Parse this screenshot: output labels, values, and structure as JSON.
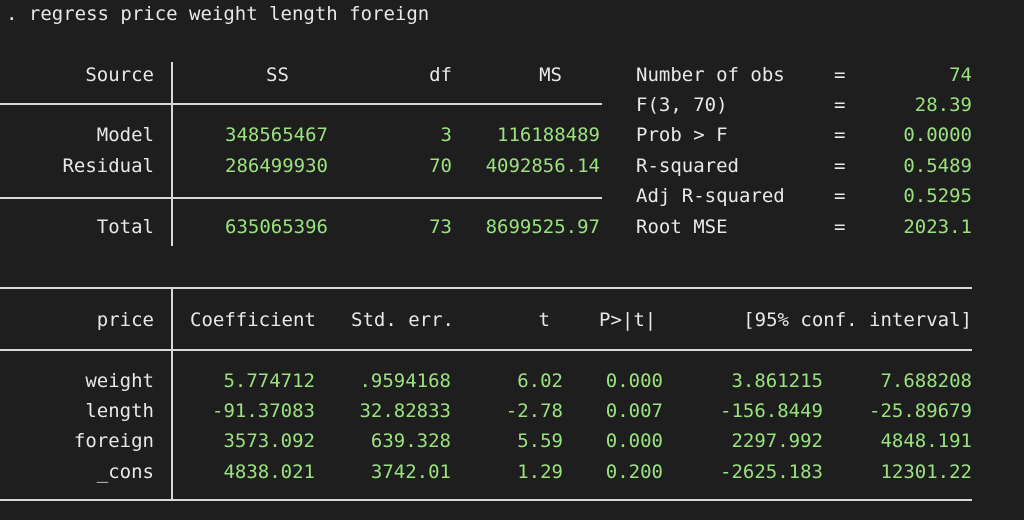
{
  "command": ". regress price weight length foreign",
  "anova": {
    "headers": {
      "source": "Source",
      "ss": "SS",
      "df": "df",
      "ms": "MS"
    },
    "rows": [
      {
        "source": "Model",
        "ss": "348565467",
        "df": "3",
        "ms": "116188489"
      },
      {
        "source": "Residual",
        "ss": "286499930",
        "df": "70",
        "ms": "4092856.14"
      }
    ],
    "total": {
      "source": "Total",
      "ss": "635065396",
      "df": "73",
      "ms": "8699525.97"
    }
  },
  "stats": [
    {
      "label": "Number of obs",
      "eq": "=",
      "value": "74"
    },
    {
      "label": "F(3, 70)",
      "eq": "=",
      "value": "28.39"
    },
    {
      "label": "Prob > F",
      "eq": "=",
      "value": "0.0000"
    },
    {
      "label": "R-squared",
      "eq": "=",
      "value": "0.5489"
    },
    {
      "label": "Adj R-squared",
      "eq": "=",
      "value": "0.5295"
    },
    {
      "label": "Root MSE",
      "eq": "=",
      "value": "2023.1"
    }
  ],
  "coef": {
    "headers": {
      "var": "price",
      "coef": "Coefficient",
      "se": "Std. err.",
      "t": "t",
      "p": "P>|t|",
      "ci": "[95% conf. interval]"
    },
    "rows": [
      {
        "var": "weight",
        "coef": "5.774712",
        "se": ".9594168",
        "t": "6.02",
        "p": "0.000",
        "lo": "3.861215",
        "hi": "7.688208"
      },
      {
        "var": "length",
        "coef": "-91.37083",
        "se": "32.82833",
        "t": "-2.78",
        "p": "0.007",
        "lo": "-156.8449",
        "hi": "-25.89679"
      },
      {
        "var": "foreign",
        "coef": "3573.092",
        "se": "639.328",
        "t": "5.59",
        "p": "0.000",
        "lo": "2297.992",
        "hi": "4848.191"
      },
      {
        "var": "_cons",
        "coef": "4838.021",
        "se": "3742.01",
        "t": "1.29",
        "p": "0.200",
        "lo": "-2625.183",
        "hi": "12301.22"
      }
    ]
  },
  "colors": {
    "background": "#1e1e1e",
    "text": "#e8e8e8",
    "value": "#9ae27e",
    "rule": "#d8d8d8"
  }
}
